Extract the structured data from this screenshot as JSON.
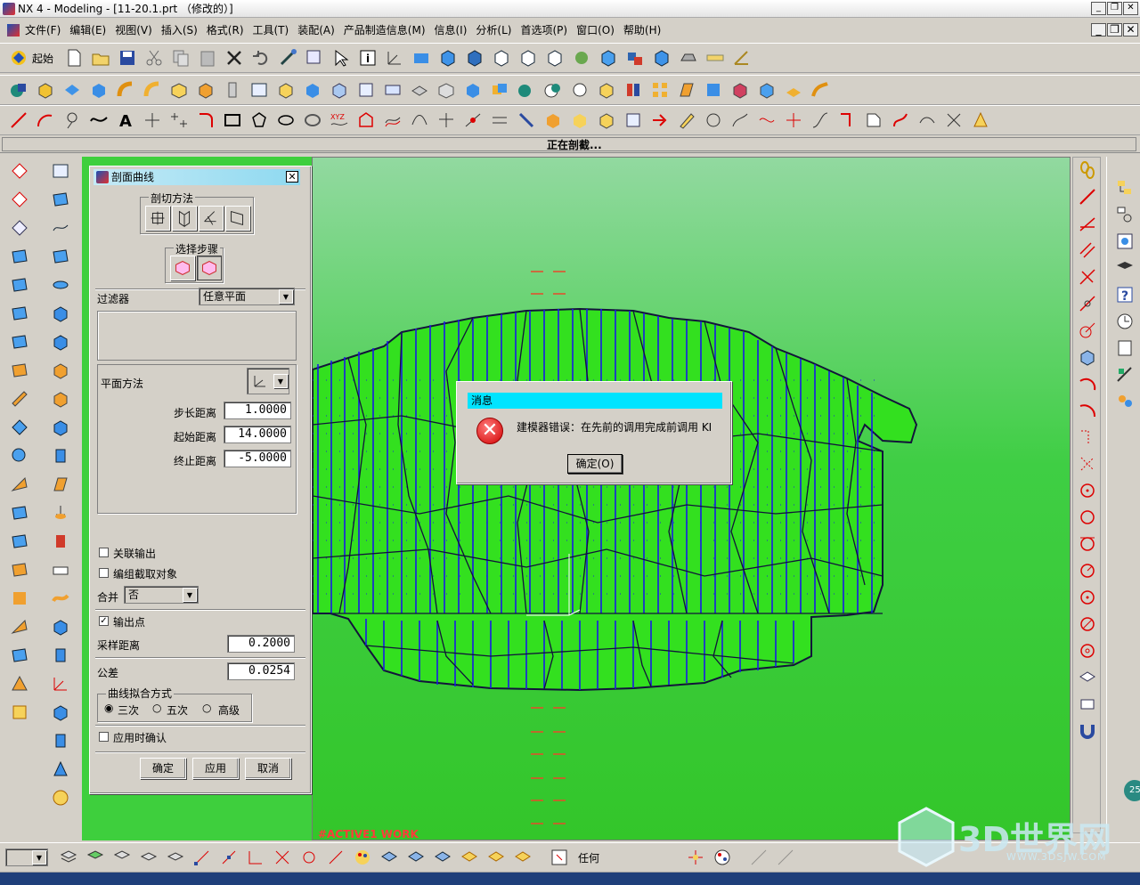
{
  "window": {
    "title": "NX 4 - Modeling - [11-20.1.prt （修改的）]"
  },
  "menu": [
    "文件(F)",
    "编辑(E)",
    "视图(V)",
    "插入(S)",
    "格式(R)",
    "工具(T)",
    "装配(A)",
    "产品制造信息(M)",
    "信息(I)",
    "分析(L)",
    "首选项(P)",
    "窗口(O)",
    "帮助(H)"
  ],
  "toolbar1": {
    "start_label": "起始"
  },
  "status": {
    "message": "正在剖截..."
  },
  "viewport": {
    "work_label": "#ACTIVE1 WORK"
  },
  "panel": {
    "title": "剖面曲线",
    "section_method_label": "剖切方法",
    "select_steps_label": "选择步骤",
    "filter_label": "过滤器",
    "filter_value": "任意平面",
    "plane_method_label": "平面方法",
    "step_distance_label": "步长距离",
    "step_distance_value": "1.0000",
    "start_distance_label": "起始距离",
    "start_distance_value": "14.0000",
    "end_distance_label": "终止距离",
    "end_distance_value": "-5.0000",
    "associative_output_label": "关联输出",
    "group_objects_label": "编组截取对象",
    "merge_label": "合并",
    "merge_value": "否",
    "output_points_label": "输出点",
    "sample_distance_label": "采样距离",
    "sample_distance_value": "0.2000",
    "tolerance_label": "公差",
    "tolerance_value": "0.0254",
    "curve_fit_label": "曲线拟合方式",
    "fit_options": [
      "三次",
      "五次",
      "高级"
    ],
    "confirm_on_apply_label": "应用时确认",
    "ok_label": "确定",
    "apply_label": "应用",
    "cancel_label": "取消"
  },
  "dialog": {
    "title": "消息",
    "message": "建模器错误：在先前的调用完成前调用 KI",
    "ok_label": "确定(O)"
  },
  "bottom": {
    "filter_value": "任何"
  },
  "watermark": {
    "brand": "3D世界网",
    "url": "WWW.3DSJW.COM"
  },
  "badge": "25",
  "colors": {
    "viewport_green": "#3fce44",
    "curve_blue": "#1a1ae6",
    "dialog_title": "#00e4ff"
  }
}
